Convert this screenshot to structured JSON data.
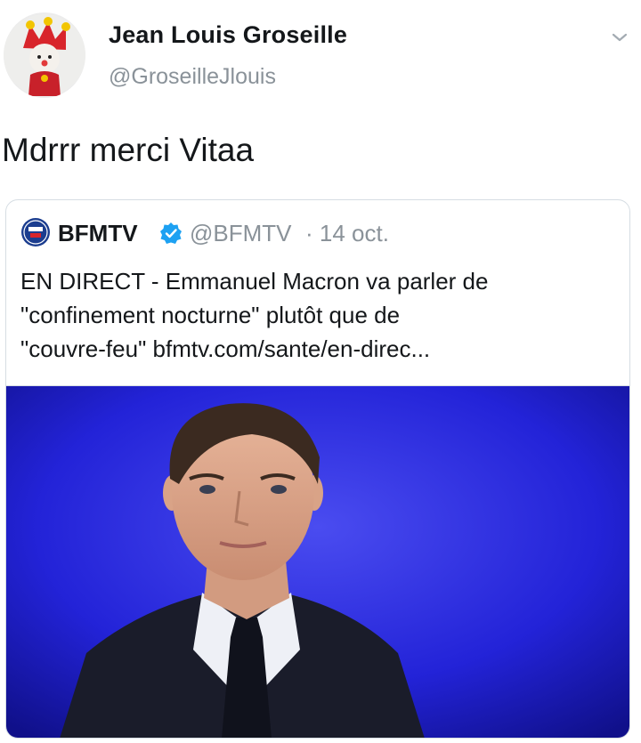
{
  "tweet": {
    "author_name": "Jean Louis Groseille",
    "author_handle": "@GroseilleJlouis",
    "text": "Mdrrr merci Vitaa",
    "menu_icon": "chevron-down-icon"
  },
  "quoted_tweet": {
    "author_name": "BFMTV",
    "author_handle": "@BFMTV",
    "date": "· 14 oct.",
    "verified_icon": "verified-badge-icon",
    "text_lines": [
      "EN DIRECT - Emmanuel Macron va parler de",
      "\"confinement nocturne\" plutôt que de",
      "\"couvre-feu\" bfmtv.com/sante/en-direc..."
    ]
  },
  "colors": {
    "verified_blue": "#1da1f2",
    "muted_text": "#8a9299",
    "photo_background": "#2323d8",
    "bfm_logo_blue": "#1b3d8f"
  }
}
